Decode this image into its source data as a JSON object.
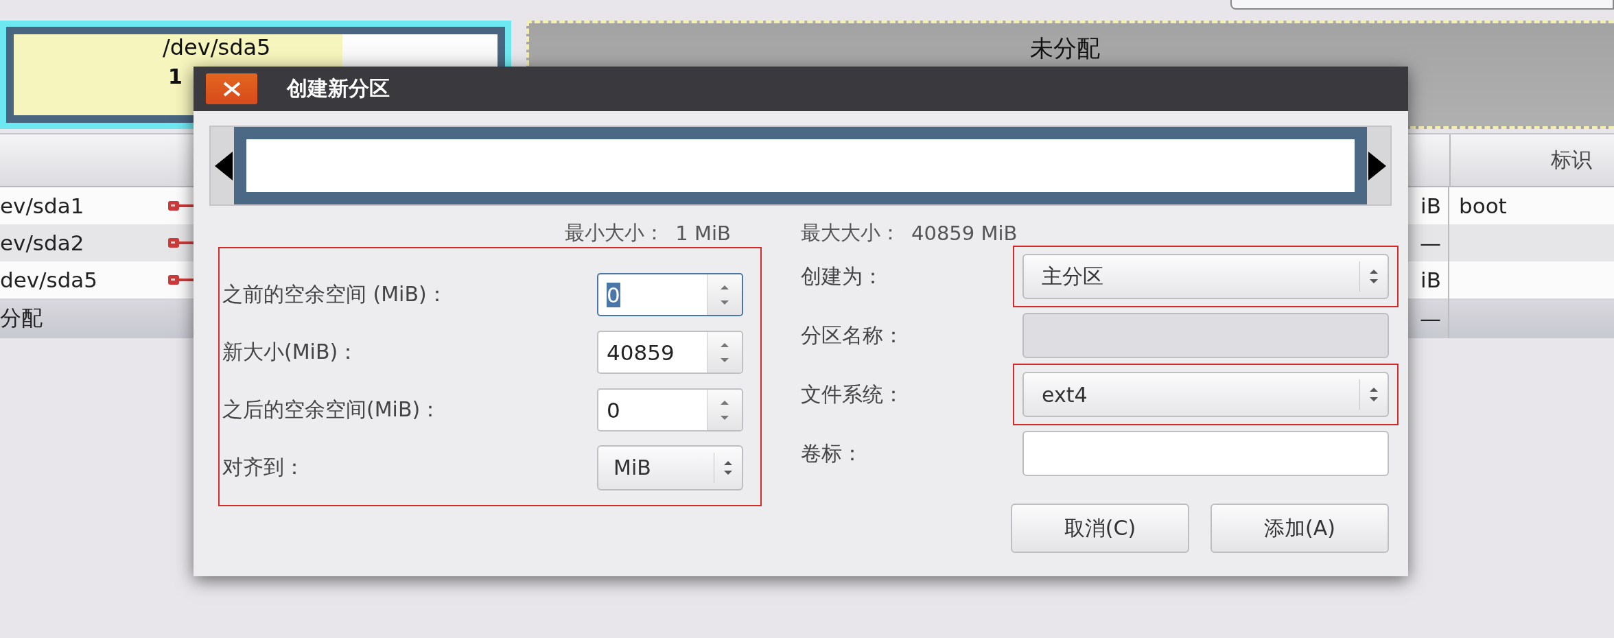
{
  "partition_map": {
    "segments": [
      {
        "kind": "partition",
        "name": "/dev/sda5",
        "size": "1",
        "level": 0.68,
        "selected": true
      },
      {
        "kind": "unallocated",
        "name": "未分配",
        "selected": false
      }
    ]
  },
  "table": {
    "header": "标识",
    "rows": [
      {
        "kind": "partition",
        "partition": "ev/sda1",
        "size": "iB",
        "flags": "boot"
      },
      {
        "kind": "partition",
        "partition": "ev/sda2",
        "size": "—"
      },
      {
        "kind": "partition",
        "partition": "dev/sda5",
        "size": "iB"
      },
      {
        "kind": "unallocated",
        "partition": "分配",
        "size": "—"
      }
    ]
  },
  "dialog": {
    "title": "创建新分区",
    "min_size_label": "最小大小：",
    "min_size": "1 MiB",
    "max_size_label": "最大大小：",
    "max_size": "40859 MiB",
    "size_group": {
      "highlighted": true,
      "fields": [
        {
          "kind": "spin",
          "label": "之前的空余空间 (MiB)：",
          "value": "0",
          "focused": true
        },
        {
          "kind": "spin",
          "label": "新大小(MiB)：",
          "value": "40859",
          "focused": false
        },
        {
          "kind": "spin",
          "label": "之后的空余空间(MiB)：",
          "value": "0",
          "focused": false
        },
        {
          "kind": "combo",
          "label": "对齐到：",
          "value": "MiB",
          "focused": false
        }
      ]
    },
    "options": [
      {
        "kind": "combo",
        "label": "创建为：",
        "value": "主分区",
        "highlighted": true,
        "disabled": false
      },
      {
        "kind": "entry",
        "label": "分区名称：",
        "highlighted": false,
        "disabled": true
      },
      {
        "kind": "combo",
        "label": "文件系统：",
        "value": "ext4",
        "highlighted": true,
        "disabled": false
      },
      {
        "kind": "entry",
        "label": "卷标：",
        "highlighted": false,
        "disabled": false
      }
    ],
    "buttons": [
      "取消(C)",
      "添加(A)"
    ]
  }
}
